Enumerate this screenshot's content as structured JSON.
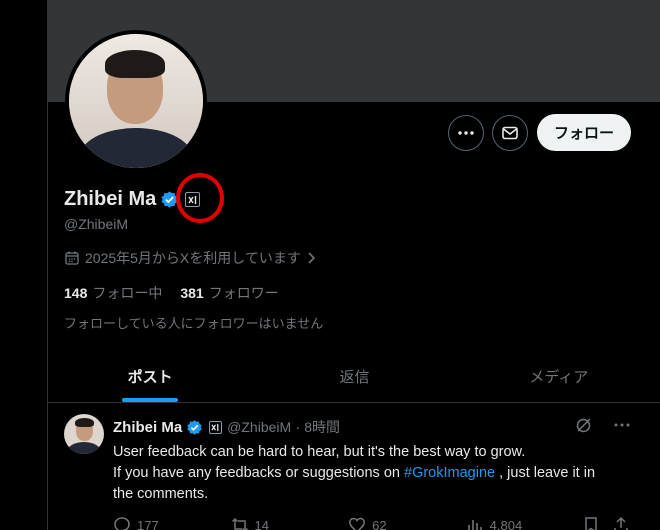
{
  "colors": {
    "accent": "#1d9bf0",
    "background": "#000000",
    "banner": "#333639",
    "muted": "#71767b",
    "annotation": "#e00000"
  },
  "profile": {
    "name": "Zhibei Ma",
    "handle": "@ZhibeiM",
    "affiliation_badge": "xAI",
    "joined": "2025年5月からXを利用しています",
    "following_count": "148",
    "following_label": "フォロー中",
    "followers_count": "381",
    "followers_label": "フォロワー",
    "followers_you_know": "フォローしている人にフォロワーはいません"
  },
  "actions": {
    "more_icon": "more-icon",
    "message_icon": "mail-icon",
    "follow_label": "フォロー"
  },
  "tabs": [
    {
      "label": "ポスト",
      "active": true
    },
    {
      "label": "返信",
      "active": false
    },
    {
      "label": "メディア",
      "active": false
    }
  ],
  "tweet": {
    "name": "Zhibei Ma",
    "handle": "@ZhibeiM",
    "separator": "·",
    "time": "8時間",
    "line1": "User feedback can be hard to hear, but it's the best way to grow.",
    "line2_before": "If you have any feedbacks or suggestions on ",
    "hashtag": "#GrokImagine",
    "line2_after": " , just leave it in",
    "line3": "the comments.",
    "replies": "177",
    "reposts": "14",
    "likes": "62",
    "views": "4,804"
  }
}
